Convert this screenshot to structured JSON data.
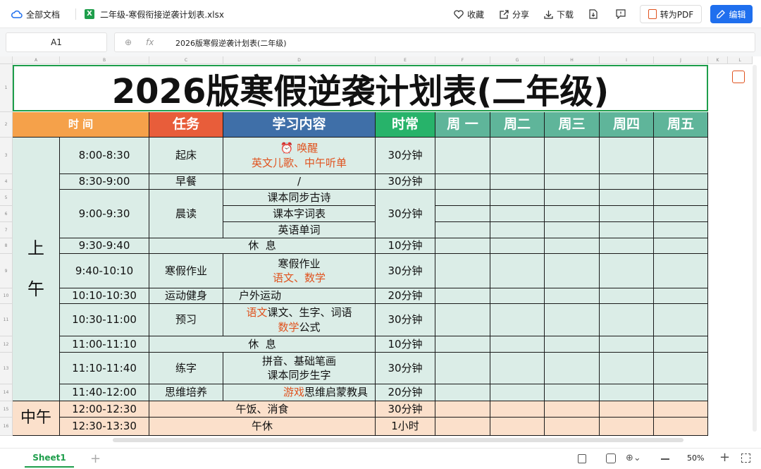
{
  "topbar": {
    "docs_label": "全部文档",
    "file_name": "二年级-寒假衔接逆袭计划表.xlsx",
    "fav_label": "收藏",
    "share_label": "分享",
    "download_label": "下载",
    "pdf_label": "转为PDF",
    "edit_label": "编辑"
  },
  "formula_bar": {
    "cell_ref": "A1",
    "fx": "fx",
    "value": "2026版寒假逆袭计划表(二年级)"
  },
  "columns": [
    "A",
    "B",
    "C",
    "D",
    "E",
    "F",
    "G",
    "H",
    "I",
    "J",
    "K",
    "L"
  ],
  "rows": [
    "1",
    "2",
    "3",
    "4",
    "5",
    "6",
    "7",
    "8",
    "9",
    "10",
    "11",
    "12",
    "13",
    "14",
    "15",
    "16"
  ],
  "sheet": {
    "title": "2026版寒假逆袭计划表(二年级)",
    "headers": {
      "time": "时 间",
      "task": "任务",
      "content": "学习内容",
      "duration": "时常",
      "mon": "周 一",
      "tue": "周二",
      "wed": "周三",
      "thu": "周四",
      "fri": "周五"
    },
    "morning": "上\n午",
    "noon": "中午",
    "r3": {
      "time": "8:00-8:30",
      "task": "起床",
      "c1": "⏰ 唤醒",
      "c2": "英文儿歌、中午听单",
      "dur": "30分钟"
    },
    "r4": {
      "time": "8:30-9:00",
      "task": "早餐",
      "c1": "/",
      "dur": "30分钟"
    },
    "r5": {
      "time": "9:00-9:30",
      "task": "晨读",
      "c1": "课本同步古诗",
      "c2": "课本字词表",
      "c3": "英语单词",
      "dur": "30分钟"
    },
    "r8": {
      "time": "9:30-9:40",
      "task": "休  息",
      "dur": "10分钟"
    },
    "r9": {
      "time": "9:40-10:10",
      "task": "寒假作业",
      "c1": "寒假作业",
      "c2": "语文、数学",
      "dur": "30分钟"
    },
    "r10": {
      "time": "10:10-10:30",
      "task": "运动健身",
      "c1": "户外运动",
      "dur": "20分钟"
    },
    "r11": {
      "time": "10:30-11:00",
      "task": "预习",
      "c1a": "语文",
      "c1b": "课文、生字、词语",
      "c2a": "数学",
      "c2b": "公式",
      "dur": "30分钟"
    },
    "r12": {
      "time": "11:00-11:10",
      "task": "休  息",
      "dur": "10分钟"
    },
    "r13": {
      "time": "11:10-11:40",
      "task": "练字",
      "c1": "拼音、基础笔画",
      "c2": "课本同步生字",
      "dur": "30分钟"
    },
    "r14": {
      "time": "11:40-12:00",
      "task": "思维培养",
      "c1a": "游戏",
      "c1b": "思维启蒙教具",
      "dur": "20分钟"
    },
    "r15": {
      "time": "12:00-12:30",
      "task": "午饭、消食",
      "dur": "30分钟"
    },
    "r16": {
      "time": "12:30-13:30",
      "task": "午休",
      "dur": "1小时"
    }
  },
  "bottom": {
    "sheet_tab": "Sheet1",
    "zoom": "50%"
  },
  "colors": {
    "accent": "#1f6fee",
    "green": "#1e9e4b",
    "orange": "#f5a14a",
    "red_header": "#e85d3a",
    "blue_header": "#3f6fa8",
    "green_header": "#27b36a",
    "weekday_header": "#5fb59a"
  }
}
